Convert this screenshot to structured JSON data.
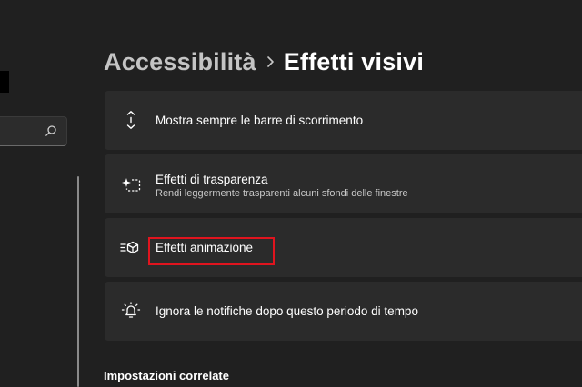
{
  "breadcrumb": {
    "parent": "Accessibilità",
    "current": "Effetti visivi"
  },
  "settings": [
    {
      "title": "Mostra sempre le barre di scorrimento",
      "icon": "scrollbar-arrows-icon"
    },
    {
      "title": "Effetti di trasparenza",
      "description": "Rendi leggermente trasparenti alcuni sfondi delle finestre",
      "icon": "transparency-sparkle-icon"
    },
    {
      "title": "Effetti animazione",
      "icon": "animation-cube-icon",
      "highlight_color": "#e0141e"
    },
    {
      "title": "Ignora le notifiche dopo questo periodo di tempo",
      "icon": "notification-bell-icon"
    }
  ],
  "related": {
    "title": "Impostazioni correlate"
  },
  "sidebar": {
    "search_icon": "search-icon"
  },
  "colors": {
    "background": "#202020",
    "card": "#2b2b2b",
    "highlight": "#e0141e"
  }
}
